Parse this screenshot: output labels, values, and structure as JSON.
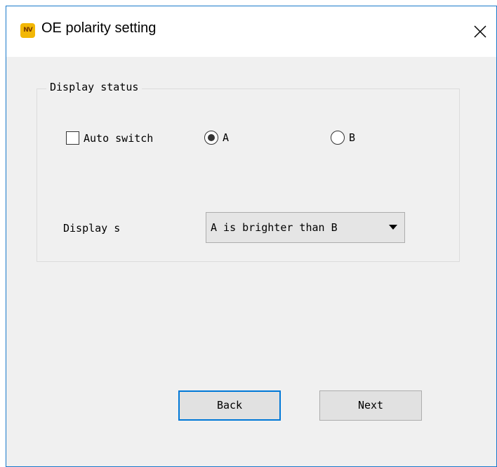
{
  "window": {
    "title": "OE polarity setting",
    "icon_name": "app-logo-icon",
    "close_icon": "close-icon"
  },
  "display_status": {
    "legend": "Display status",
    "auto_switch_label": "Auto switch",
    "auto_switch_checked": false,
    "radio_a_label": "A",
    "radio_b_label": "B",
    "selected": "A",
    "display_label": "Display s",
    "dropdown_value": "A is brighter than B"
  },
  "buttons": {
    "back_label": "Back",
    "next_label": "Next"
  },
  "colors": {
    "accent": "#0078d7",
    "window_bg": "#f0f0f0",
    "icon_bg": "#f2b705"
  }
}
